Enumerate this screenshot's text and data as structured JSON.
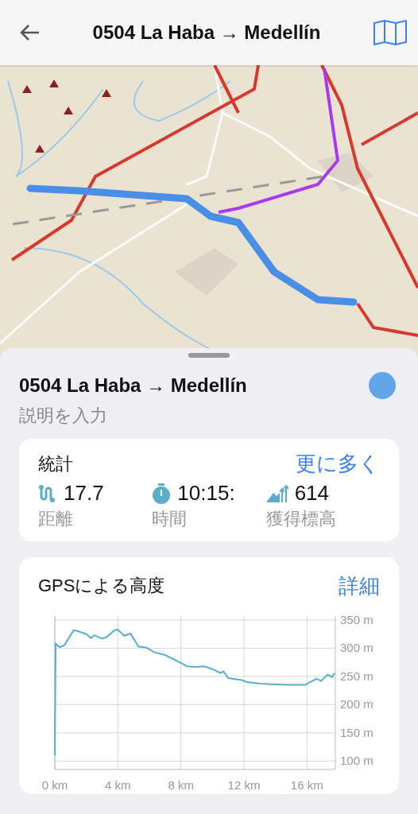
{
  "header": {
    "title": "0504 La Haba → Medellín"
  },
  "track": {
    "title": "0504 La Haba → Medellín",
    "description": {
      "placeholder": "説明を入力"
    }
  },
  "stats": {
    "title": "統計",
    "more_link": "更に多く",
    "items": [
      {
        "kind": "distance",
        "value": "17.7",
        "label": "距離"
      },
      {
        "kind": "time",
        "value": "10:15:",
        "label": "時間"
      },
      {
        "kind": "ascent",
        "value": "614",
        "label": "獲得標高"
      }
    ]
  },
  "elevation": {
    "title": "GPSによる高度",
    "details_link": "詳細",
    "chart_data": {
      "type": "line",
      "grid": true,
      "xlim": [
        0,
        17.8
      ],
      "ylim": [
        85,
        357
      ],
      "xticks": [
        {
          "value": 0,
          "label": "0 km"
        },
        {
          "value": 4,
          "label": "4 km"
        },
        {
          "value": 8,
          "label": "8 km"
        },
        {
          "value": 12,
          "label": "12 km"
        },
        {
          "value": 16,
          "label": "16 km"
        }
      ],
      "yticks": [
        {
          "value": 100,
          "label": "100 m"
        },
        {
          "value": 150,
          "label": "150 m"
        },
        {
          "value": 200,
          "label": "200 m"
        },
        {
          "value": 250,
          "label": "250 m"
        },
        {
          "value": 300,
          "label": "300 m"
        },
        {
          "value": 350,
          "label": "350 m"
        }
      ],
      "x": [
        0,
        0.05,
        0.3,
        0.6,
        1.2,
        1.5,
        2,
        2.3,
        2.5,
        3,
        3.3,
        3.8,
        4,
        4.4,
        4.8,
        5.3,
        5.8,
        6.3,
        7,
        8,
        8.4,
        9,
        9.5,
        10,
        10.5,
        10.7,
        11,
        11.8,
        12.2,
        13,
        14,
        15,
        15.9,
        16.2,
        16.6,
        16.9,
        17.3,
        17.6,
        17.75
      ],
      "series": [
        {
          "color": "#5aaec8",
          "values": [
            110,
            308,
            302,
            305,
            332,
            330,
            325,
            318,
            323,
            317,
            320,
            332,
            333,
            322,
            326,
            303,
            301,
            293,
            288,
            274,
            268,
            267,
            268,
            263,
            256,
            259,
            247,
            244,
            240,
            237,
            236,
            235,
            235,
            240,
            246,
            242,
            253,
            249,
            256
          ]
        }
      ]
    }
  }
}
